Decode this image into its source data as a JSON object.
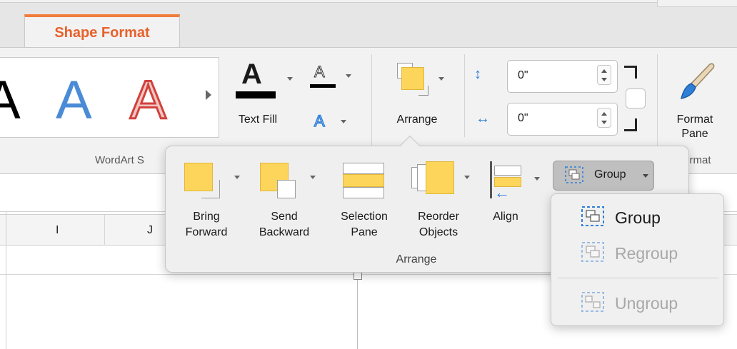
{
  "tabs": {
    "active": "Shape Format"
  },
  "ribbon": {
    "wordart_group_label": "WordArt S",
    "text_fill_label": "Text Fill",
    "arrange_label": "Arrange",
    "height_value": "0\"",
    "width_value": "0\"",
    "format_pane_label": [
      "Format",
      "Pane"
    ],
    "format_group_label": "Format"
  },
  "columns": [
    "I",
    "J"
  ],
  "arrange_popover": {
    "bring_forward": [
      "Bring",
      "Forward"
    ],
    "send_backward": [
      "Send",
      "Backward"
    ],
    "selection_pane": [
      "Selection",
      "Pane"
    ],
    "reorder_objects": [
      "Reorder",
      "Objects"
    ],
    "align": "Align",
    "group_button": "Group",
    "section_label": "Arrange"
  },
  "group_menu": {
    "items": [
      {
        "label": "Group",
        "enabled": true
      },
      {
        "label": "Regroup",
        "enabled": false
      },
      {
        "label": "Ungroup",
        "enabled": false
      }
    ]
  },
  "colors": {
    "accent": "#e8612b",
    "shape_yellow": "#fcd55a",
    "wordart_blue": "#4a8bd6",
    "wordart_red": "#d2413c",
    "disabled_text": "#a8a8a8"
  }
}
